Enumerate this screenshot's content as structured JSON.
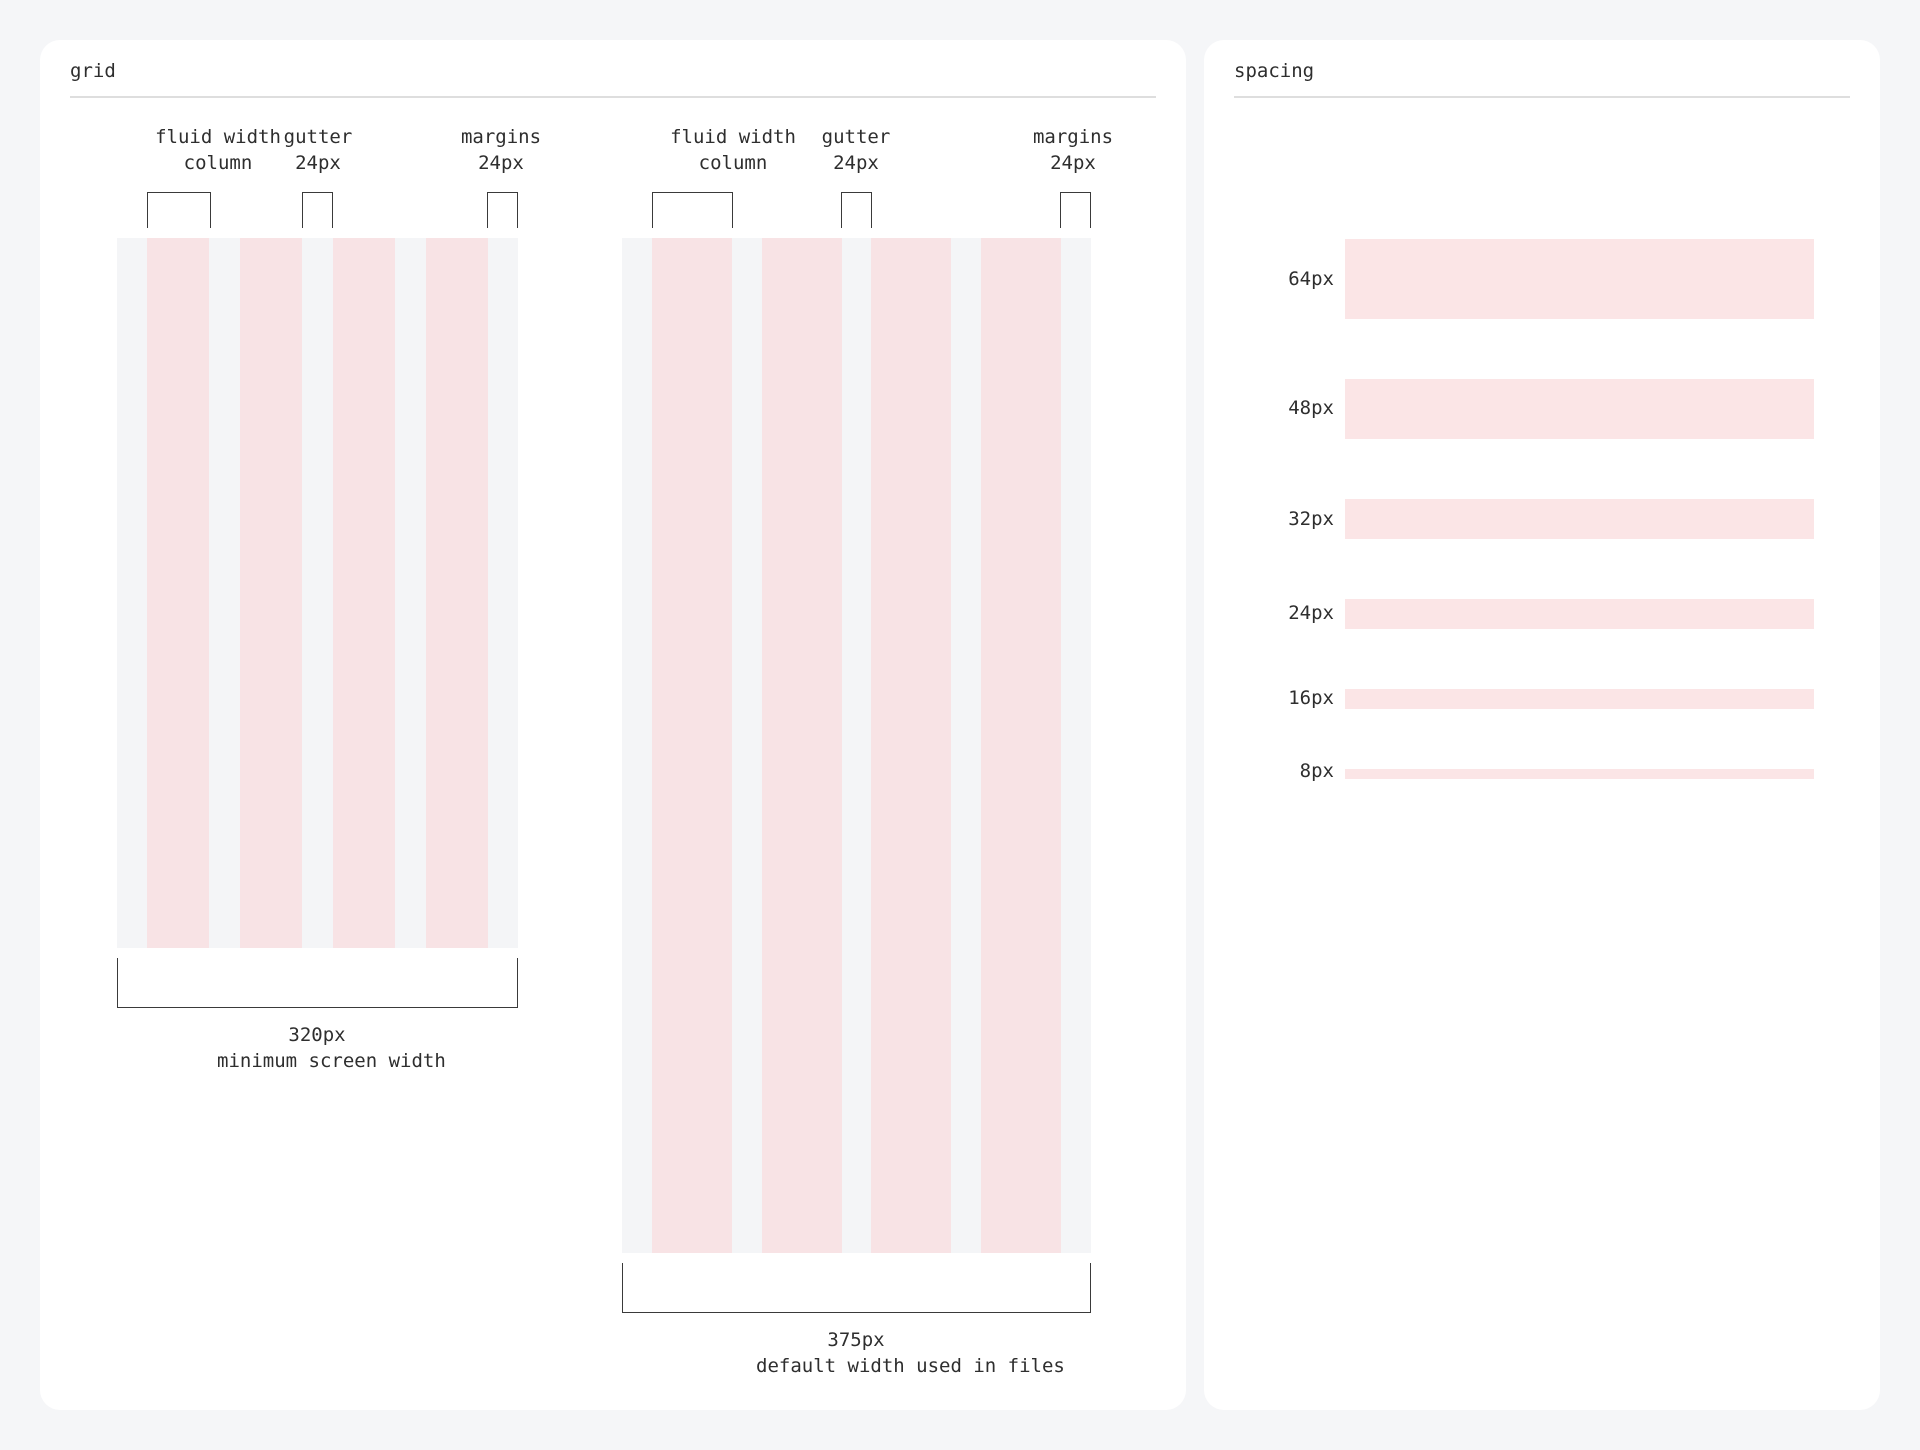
{
  "grid": {
    "title": "grid",
    "left_grid": {
      "col_label_1": "fluid width",
      "col_label_2": "column",
      "gutter_label_1": "gutter",
      "gutter_label_2": "24px",
      "margin_label_1": "margins",
      "margin_label_2": "24px",
      "width_value": "320px",
      "width_caption": "minimum screen width"
    },
    "right_grid": {
      "col_label_1": "fluid width",
      "col_label_2": "column",
      "gutter_label_1": "gutter",
      "gutter_label_2": "24px",
      "margin_label_1": "margins",
      "margin_label_2": "24px",
      "width_value": "375px",
      "width_caption": "default width used in files"
    },
    "colors": {
      "column": "#f8e3e5",
      "background": "#f4f5f7"
    }
  },
  "spacing": {
    "title": "spacing",
    "items": [
      {
        "label": "64px",
        "value": 64
      },
      {
        "label": "48px",
        "value": 48
      },
      {
        "label": "32px",
        "value": 32
      },
      {
        "label": "24px",
        "value": 24
      },
      {
        "label": "16px",
        "value": 16
      },
      {
        "label": "8px",
        "value": 8
      }
    ],
    "colors": {
      "bar": "#fbe5e6"
    }
  }
}
